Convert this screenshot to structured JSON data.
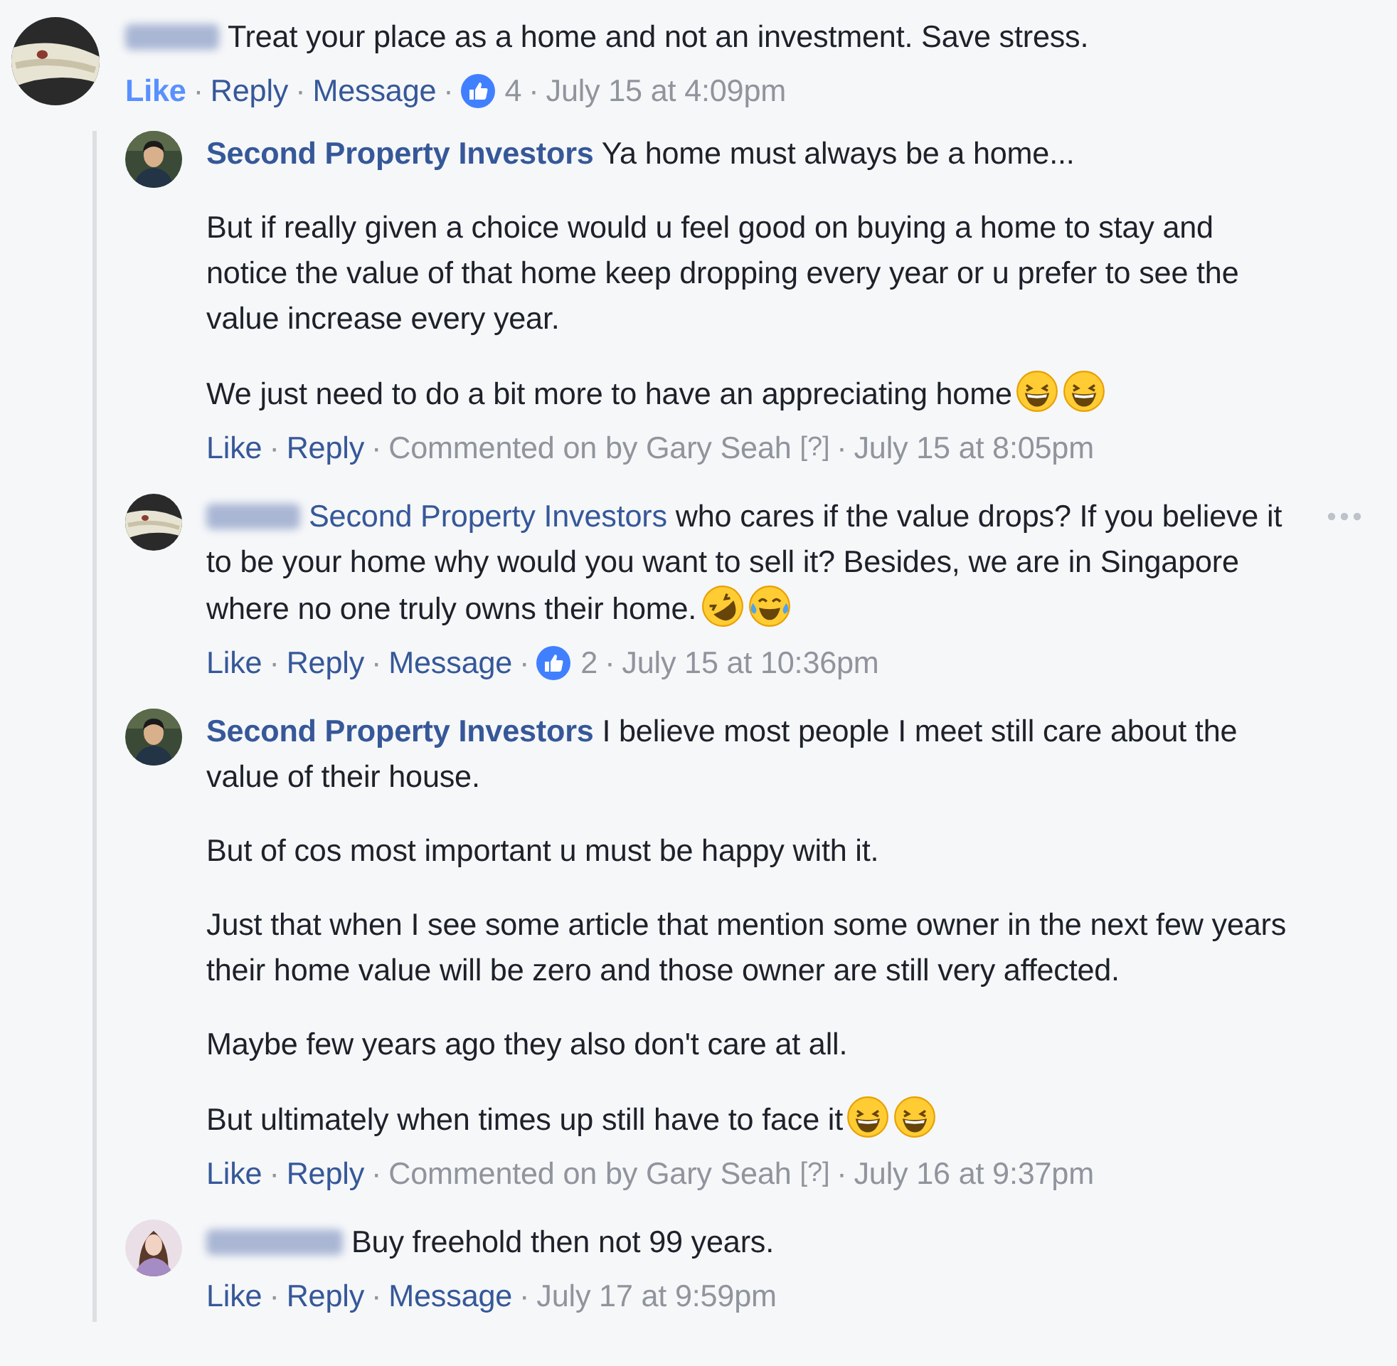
{
  "comment": {
    "author_hidden": true,
    "paragraphs": [
      {
        "text": "Treat your place as a home and not an investment. Save stress."
      }
    ],
    "actions": [
      {
        "kind": "like",
        "label": "Like",
        "liked": true
      },
      {
        "kind": "link",
        "label": "Reply",
        "sep": "·"
      },
      {
        "kind": "link",
        "label": "Message",
        "sep": "·"
      },
      {
        "kind": "likes",
        "count": "4",
        "sep": "·"
      },
      {
        "kind": "time",
        "label": "July 15 at 4:09pm",
        "sep": "·"
      }
    ]
  },
  "replies": [
    {
      "author": "Second Property Investors",
      "paragraphs": [
        {
          "text": "Ya home must always be a home..."
        },
        {
          "text": "But if really given a choice would u feel good on buying a home to stay and notice the value of that home keep dropping every year or u prefer to see the value increase every year."
        },
        {
          "text": "We just need to do a bit more to have an appreciating home",
          "emojis": [
            {
              "kind": "grin"
            },
            {
              "kind": "grin"
            }
          ]
        }
      ],
      "actions": [
        {
          "kind": "like",
          "label": "Like",
          "liked": false
        },
        {
          "kind": "link",
          "label": "Reply",
          "sep": "·"
        },
        {
          "kind": "note",
          "label": "Commented on by Gary Seah",
          "help": "[?]",
          "sep": "·"
        },
        {
          "kind": "time",
          "label": "July 15 at 8:05pm",
          "sep": "·"
        }
      ]
    },
    {
      "author_hidden": true,
      "mention": "Second Property Investors",
      "more": true,
      "paragraphs": [
        {
          "text": "who cares if the value drops? If you believe it to be your home why would you want to sell it? Besides, we are in Singapore where no one truly owns their home.",
          "emojis": [
            {
              "kind": "rofl"
            },
            {
              "kind": "joy"
            }
          ]
        }
      ],
      "actions": [
        {
          "kind": "like",
          "label": "Like",
          "liked": false
        },
        {
          "kind": "link",
          "label": "Reply",
          "sep": "·"
        },
        {
          "kind": "link",
          "label": "Message",
          "sep": "·"
        },
        {
          "kind": "likes",
          "count": "2",
          "sep": "·"
        },
        {
          "kind": "time",
          "label": "July 15 at 10:36pm",
          "sep": "·"
        }
      ]
    },
    {
      "author": "Second Property Investors",
      "paragraphs": [
        {
          "text": "I believe most people I meet still care about the value of their house."
        },
        {
          "text": "But of cos most important u must be happy with it."
        },
        {
          "text": "Just that when I see some article that mention some owner in the next few years their home value will be zero and those owner are still very affected."
        },
        {
          "text": "Maybe few years ago they also don't care at all."
        },
        {
          "text": "But ultimately when times up still have to face it",
          "emojis": [
            {
              "kind": "grin"
            },
            {
              "kind": "grin"
            }
          ]
        }
      ],
      "actions": [
        {
          "kind": "like",
          "label": "Like",
          "liked": false
        },
        {
          "kind": "link",
          "label": "Reply",
          "sep": "·"
        },
        {
          "kind": "note",
          "label": "Commented on by Gary Seah",
          "help": "[?]",
          "sep": "·"
        },
        {
          "kind": "time",
          "label": "July 16 at 9:37pm",
          "sep": "·"
        }
      ]
    },
    {
      "author_hidden": true,
      "paragraphs": [
        {
          "text": "Buy freehold then not 99 years."
        }
      ],
      "actions": [
        {
          "kind": "like",
          "label": "Like",
          "liked": false
        },
        {
          "kind": "link",
          "label": "Reply",
          "sep": "·"
        },
        {
          "kind": "link",
          "label": "Message",
          "sep": "·"
        },
        {
          "kind": "time",
          "label": "July 17 at 9:59pm",
          "sep": "·"
        }
      ]
    }
  ]
}
